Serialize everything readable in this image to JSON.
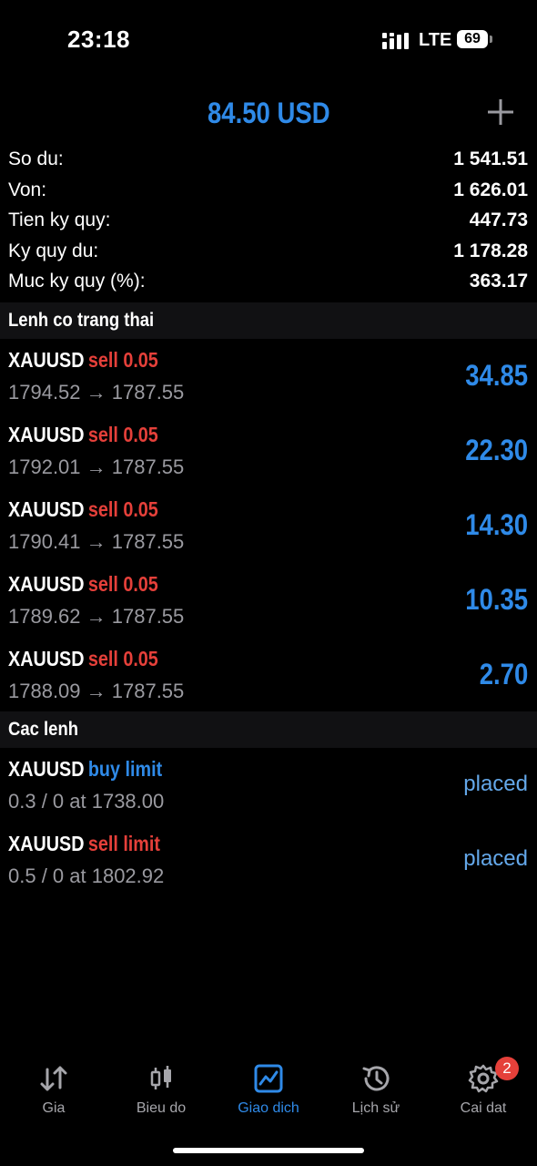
{
  "status_bar": {
    "time": "23:18",
    "network": "LTE",
    "battery": "69"
  },
  "header": {
    "balance": "84.50 USD",
    "add_icon": "plus-icon"
  },
  "summary": [
    {
      "label": "So du:",
      "value": "1 541.51"
    },
    {
      "label": "Von:",
      "value": "1 626.01"
    },
    {
      "label": "Tien ky quy:",
      "value": "447.73"
    },
    {
      "label": "Ky quy du:",
      "value": "1 178.28"
    },
    {
      "label": "Muc ky quy (%):",
      "value": "363.17"
    }
  ],
  "positions_section": {
    "title": "Lenh co trang thai",
    "items": [
      {
        "symbol": "XAUUSD",
        "side": "sell 0.05",
        "prices": "1794.52 → 1787.55",
        "profit": "34.85"
      },
      {
        "symbol": "XAUUSD",
        "side": "sell 0.05",
        "prices": "1792.01 → 1787.55",
        "profit": "22.30"
      },
      {
        "symbol": "XAUUSD",
        "side": "sell 0.05",
        "prices": "1790.41 → 1787.55",
        "profit": "14.30"
      },
      {
        "symbol": "XAUUSD",
        "side": "sell 0.05",
        "prices": "1789.62 → 1787.55",
        "profit": "10.35"
      },
      {
        "symbol": "XAUUSD",
        "side": "sell 0.05",
        "prices": "1788.09 → 1787.55",
        "profit": "2.70"
      }
    ]
  },
  "orders_section": {
    "title": "Cac lenh",
    "items": [
      {
        "symbol": "XAUUSD",
        "side": "buy limit",
        "detail": "0.3 / 0 at 1738.00",
        "status": "placed"
      },
      {
        "symbol": "XAUUSD",
        "side": "sell limit",
        "detail": "0.5 / 0 at 1802.92",
        "status": "placed"
      }
    ]
  },
  "tabs": [
    {
      "label": "Gia",
      "icon": "sort-arrows-icon"
    },
    {
      "label": "Bieu do",
      "icon": "candlestick-icon"
    },
    {
      "label": "Giao dich",
      "icon": "trade-chart-icon",
      "active": true
    },
    {
      "label": "Lịch sử",
      "icon": "history-icon"
    },
    {
      "label": "Cai dat",
      "icon": "gear-icon",
      "badge": "2"
    }
  ],
  "colors": {
    "accent": "#2f8ae8",
    "sell": "#e5403a",
    "buy": "#2f8ae8",
    "background": "#000000",
    "section_bg": "#111113"
  }
}
